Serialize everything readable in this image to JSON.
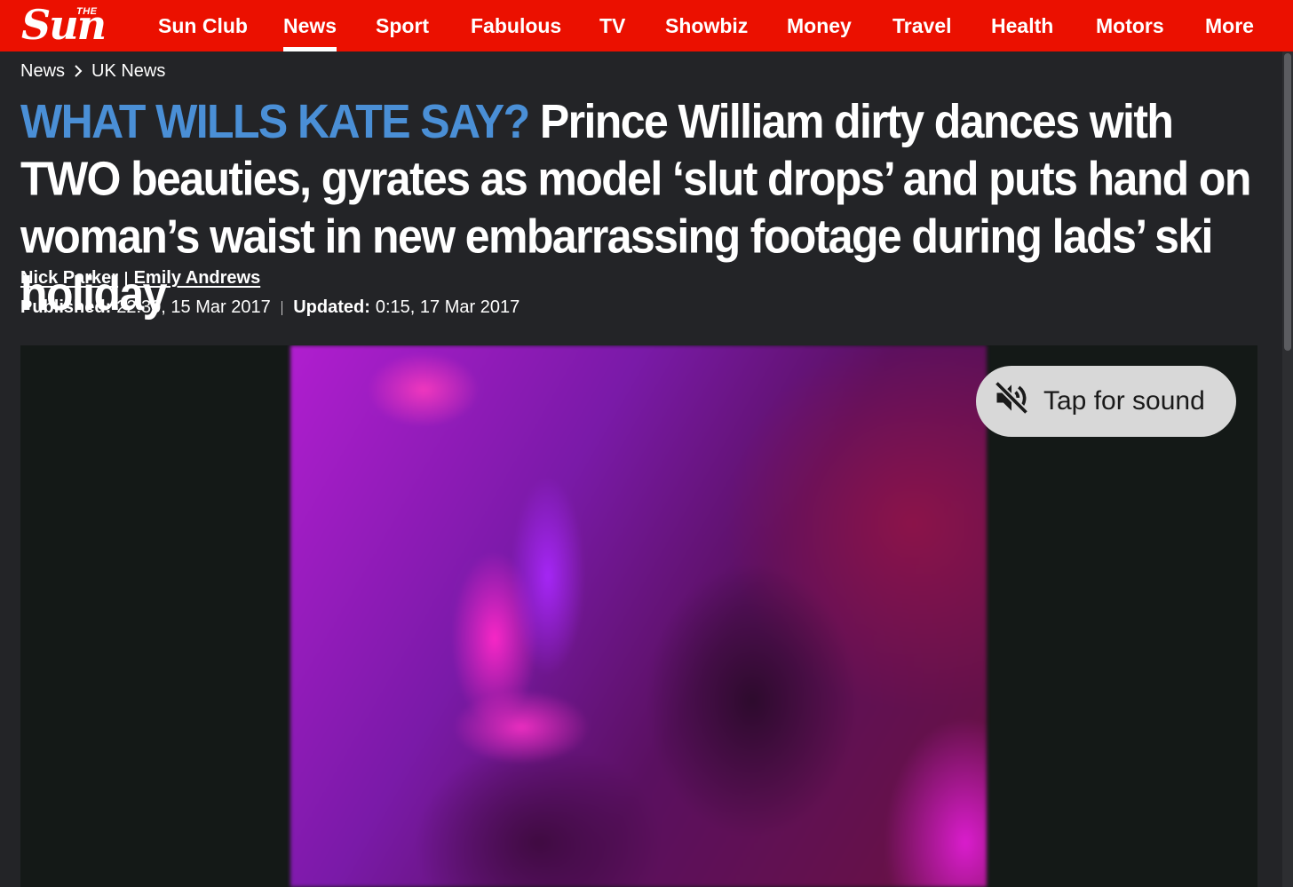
{
  "brand": {
    "logo_small": "THE",
    "logo_main": "Sun"
  },
  "nav": {
    "items": [
      "Sun Club",
      "News",
      "Sport",
      "Fabulous",
      "TV",
      "Showbiz",
      "Money",
      "Travel",
      "Health",
      "Motors",
      "More"
    ],
    "active": "News"
  },
  "breadcrumb": {
    "items": [
      "News",
      "UK News"
    ]
  },
  "article": {
    "kicker": "WHAT WILLS KATE SAY?",
    "headline": "Prince William dirty dances with TWO beauties, gyrates as model ‘slut drops’ and puts hand on woman’s waist in new embarrassing footage during lads’ ski holiday",
    "authors": [
      "Nick Parker",
      "Emily Andrews"
    ],
    "published_label": "Published:",
    "published": "22:30, 15 Mar 2017",
    "updated_label": "Updated:",
    "updated": "0:15, 17 Mar 2017"
  },
  "video": {
    "sound_label": "Tap for sound",
    "sound_icon": "muted-speaker-icon"
  },
  "colors": {
    "nav_bg": "#eb1000",
    "page_bg": "#232427",
    "kicker": "#4a8fd6",
    "pill_bg": "#d8d8d8"
  }
}
